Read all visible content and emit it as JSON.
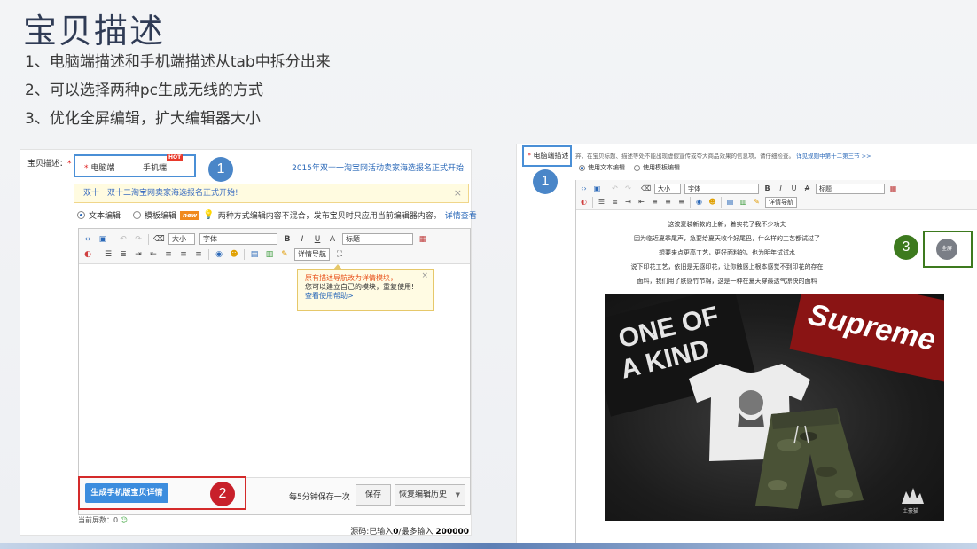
{
  "slide": {
    "title": "宝贝描述",
    "bullets": [
      "1、电脑端描述和手机端描述从tab中拆分出来",
      "2、可以选择两种pc生成无线的方式",
      "3、优化全屏编辑，扩大编辑器大小"
    ]
  },
  "left": {
    "field_label": "宝贝描述：",
    "required_mark": "*",
    "tab_pc": "电脑端",
    "tab_mobile": "手机端",
    "hot_badge": "HOT",
    "callout_1": "1",
    "callout_2": "2",
    "event_link": "2015年双十一淘宝网活动卖家海选报名正式开始",
    "notice": "双十一双十二淘宝网卖家海选报名正式开始!",
    "notice_close": "×",
    "mode_text": "文本编辑",
    "mode_template": "模板编辑",
    "new_badge": "new",
    "mode_hint": "两种方式编辑内容不混合，发布宝贝时只应用当前编辑器内容。",
    "mode_hint_link": "详情查看",
    "toolbar": {
      "size": "大小",
      "font": "字体",
      "title": "标题",
      "nav_btn": "详情导航"
    },
    "tooltip": {
      "line1": "原有描述导航改为详情模块，",
      "line2": "您可以建立自己的模块，重复使用!",
      "line3": "查看使用帮助>",
      "close": "×"
    },
    "generate_btn": "生成手机版宝贝详情",
    "autosave": "每5分钟保存一次",
    "save_btn": "保存",
    "restore_btn": "恢复编辑历史",
    "screens_label": "当前屏数：",
    "screens_value": "0",
    "source_label": "源码:已输入",
    "source_value": "0",
    "source_max_label": "/最多输入",
    "source_max": "200000"
  },
  "right": {
    "tab_pc": "电脑端描述",
    "required_mark": "*",
    "hint": "弃，在宝贝标题、描述等处不能出现虚假宣传或夸大商品效果的信息项，请仔细检查。",
    "hint_link": "详见规则中第十二第三节 >>",
    "mode_text": "使用文本编辑",
    "mode_template": "使用模板编辑",
    "callout_1": "1",
    "callout_3": "3",
    "toolbar": {
      "size": "大小",
      "font": "字体",
      "title": "标题",
      "nav_btn": "详情导航"
    },
    "text_lines": [
      "这波夏装新款的上新，着实花了我不少功夫",
      "因为临近夏季尾声，急要给夏天收个好尾巴，什么样的工艺都试过了",
      "想要来点更高工艺，更好面料的，也为明年试试水",
      "说下印花工艺，依旧是无感印花，让你触感上根本感觉不到印花的存在",
      "面料，我们用了肤感竹节棉，这是一种在夏天穿最透气凉快的面料"
    ],
    "fullscreen_btn": "全屏",
    "photo": {
      "text_one_of_a_kind_1": "ONE OF",
      "text_one_of_a_kind_2": "A KIND",
      "text_supreme": "Supreme",
      "brand": "土豪猫"
    }
  }
}
